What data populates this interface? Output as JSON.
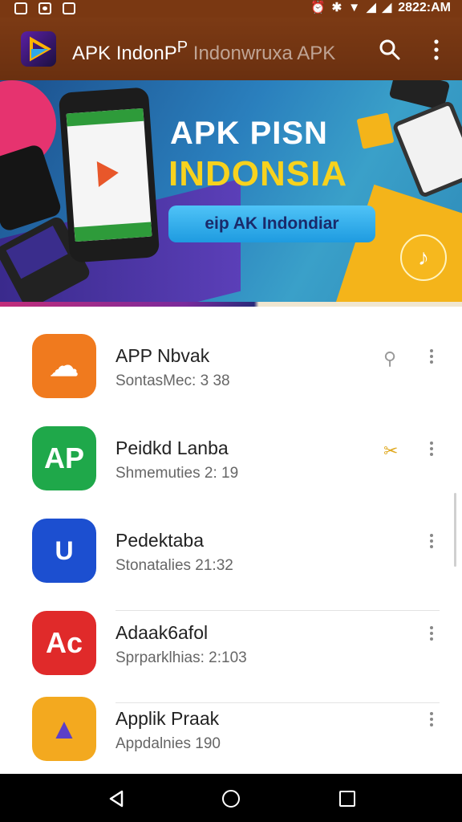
{
  "status_bar": {
    "time": "2822:AM",
    "icons": [
      "photo-icon",
      "camera-icon",
      "mail-icon",
      "alarm-icon",
      "bluetooth-icon",
      "wifi-icon",
      "signal-icon",
      "signal-icon-2"
    ]
  },
  "app_bar": {
    "title": "APK IndonP",
    "title_super": "P",
    "subtitle": " Indonwruxa APK",
    "actions": [
      "search-icon",
      "more-vert-icon"
    ],
    "color": "#7a3812"
  },
  "banner": {
    "title_line1": "APK PISN",
    "title_line2": "INDONSIA",
    "title_line2_color": "#f7d21e",
    "button_label": "eip AK Indondiar",
    "play_glyph": "♪"
  },
  "apps": [
    {
      "name": "APP Nbvak",
      "meta": "SontasMec: 3 38",
      "icon_color": "#f07a1e",
      "icon_glyph": "☁",
      "extra": "⚲",
      "extra_style": "gray"
    },
    {
      "name": "Peidkd Lanba",
      "meta": "Shmemuties 2: 19",
      "icon_color": "#1fa84a",
      "icon_glyph": "AP",
      "extra": "✂",
      "extra_style": "gold"
    },
    {
      "name": "Pedektaba",
      "meta": "Stonatalies 21:32",
      "icon_color": "#1c4fd0",
      "icon_glyph": "U",
      "extra": "",
      "extra_style": ""
    },
    {
      "name": "Adaak6afol",
      "meta": "Sprparklhias: 2:103",
      "icon_color": "#e02a2a",
      "icon_glyph": "Ac",
      "extra": "",
      "extra_style": ""
    },
    {
      "name": "Applik Praak",
      "meta": "Appdalnies 190",
      "icon_color": "#f3a91f",
      "icon_glyph": "▲",
      "extra": "",
      "extra_style": ""
    }
  ],
  "nav_bar": {
    "buttons": [
      "back-icon",
      "home-icon",
      "recents-icon"
    ]
  }
}
